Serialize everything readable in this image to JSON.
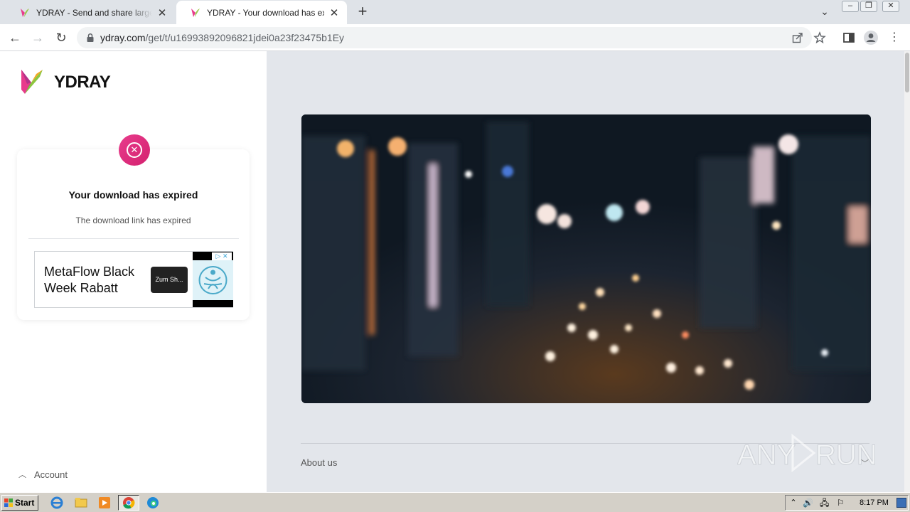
{
  "browser": {
    "tabs": [
      {
        "title": "YDRAY - Send and share large and big",
        "active": false
      },
      {
        "title": "YDRAY - Your download has expired",
        "active": true
      }
    ],
    "url_host": "ydray.com",
    "url_path": "/get/t/u16993892096821jdei0a23f23475b1Ey"
  },
  "page": {
    "brand": "YDRAY",
    "status_title": "Your download has expired",
    "status_subtitle": "The download link has expired",
    "ad": {
      "headline": "MetaFlow Black Week Rabatt",
      "cta": "Zum Sh..."
    },
    "account_label": "Account",
    "footer": {
      "about_label": "About us"
    },
    "watermark": "ANY RUN"
  },
  "taskbar": {
    "start_label": "Start",
    "clock": "8:17 PM"
  },
  "colors": {
    "accent_pink": "#e83c8c",
    "page_bg_right": "#e3e6eb",
    "tabstrip_bg": "#dfe3e8"
  },
  "icons": [
    "ydray-logo",
    "error-x-icon",
    "lock-icon",
    "share-icon",
    "star-icon",
    "sidepanel-icon",
    "profile-icon",
    "menu-icon"
  ]
}
